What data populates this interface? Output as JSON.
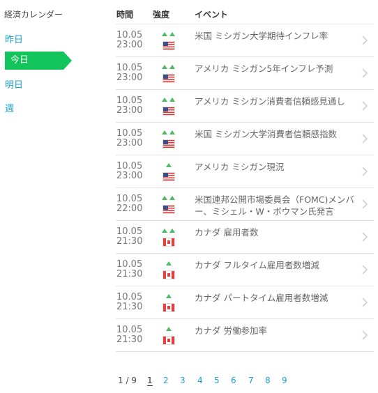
{
  "sidebar": {
    "title": "経済カレンダー",
    "items": [
      {
        "label": "昨日"
      },
      {
        "label": "今日",
        "active": true
      },
      {
        "label": "明日"
      },
      {
        "label": "週"
      }
    ]
  },
  "table": {
    "columns": {
      "time": "時間",
      "strength": "強度",
      "event": "イベント"
    },
    "rows": [
      {
        "date": "10.05",
        "time": "23:00",
        "strength": 2,
        "country": "us-flag",
        "event": "米国 ミシガン大学期待インフレ率"
      },
      {
        "date": "10.05",
        "time": "23:00",
        "strength": 2,
        "country": "us-flag",
        "event": "アメリカ ミシガン5年インフレ予測"
      },
      {
        "date": "10.05",
        "time": "23:00",
        "strength": 2,
        "country": "us-flag",
        "event": "アメリカ ミシガン消費者信頼感見通し"
      },
      {
        "date": "10.05",
        "time": "23:00",
        "strength": 2,
        "country": "us-flag",
        "event": "米国 ミシガン大学消費者信頼感指数"
      },
      {
        "date": "10.05",
        "time": "23:00",
        "strength": 1,
        "country": "us-flag",
        "event": "アメリカ ミシガン現況"
      },
      {
        "date": "10.05",
        "time": "22:00",
        "strength": 2,
        "country": "us-flag",
        "event": "米国連邦公開市場委員会（FOMC)メンバー、ミシェル・W・ボウマン氏発言"
      },
      {
        "date": "10.05",
        "time": "21:30",
        "strength": 2,
        "country": "ca-flag",
        "event": "カナダ 雇用者数"
      },
      {
        "date": "10.05",
        "time": "21:30",
        "strength": 1,
        "country": "ca-flag",
        "event": "カナダ フルタイム雇用者数増減"
      },
      {
        "date": "10.05",
        "time": "21:30",
        "strength": 1,
        "country": "ca-flag",
        "event": "カナダ パートタイム雇用者数増減"
      },
      {
        "date": "10.05",
        "time": "21:30",
        "strength": 1,
        "country": "ca-flag",
        "event": "カナダ 労働参加率"
      }
    ]
  },
  "pagination": {
    "info": "1 / 9",
    "pages": [
      "1",
      "2",
      "3",
      "4",
      "5",
      "6",
      "7",
      "8",
      "9"
    ],
    "current": "1"
  },
  "colors": {
    "accent": "#12c45a",
    "link": "#1aa0c8",
    "strength_arrow": "#4dbb62"
  }
}
